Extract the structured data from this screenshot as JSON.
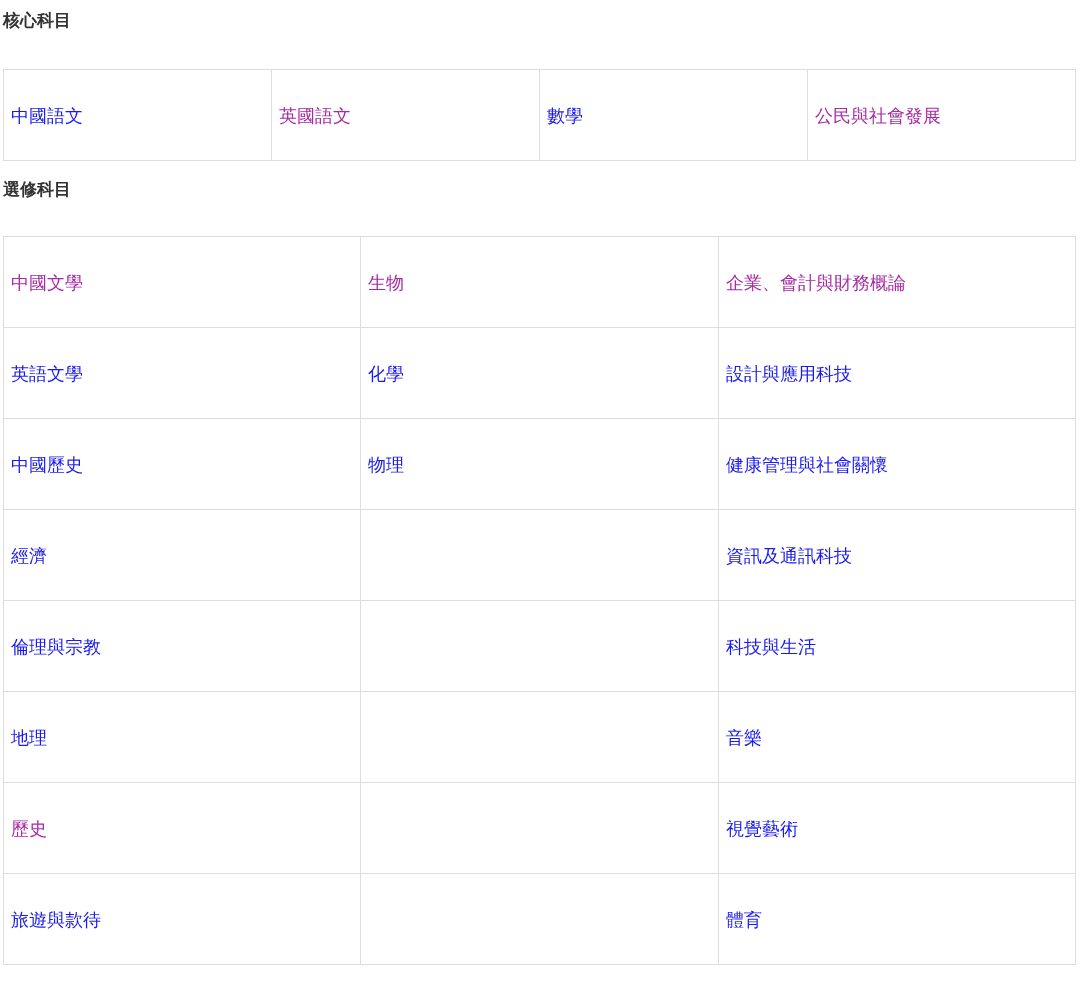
{
  "sections": [
    {
      "heading": "核心科目",
      "rows": [
        {
          "cells": [
            {
              "kind": "link",
              "label": "中國語文",
              "visited": false
            },
            {
              "kind": "link",
              "label": "英國語文",
              "visited": true
            },
            {
              "kind": "link",
              "label": "數學",
              "visited": false
            },
            {
              "kind": "link",
              "label": "公民與社會發展",
              "visited": true
            }
          ]
        }
      ]
    },
    {
      "heading": "選修科目",
      "rows": [
        {
          "cells": [
            {
              "kind": "link",
              "label": "中國文學",
              "visited": true
            },
            {
              "kind": "link",
              "label": "生物",
              "visited": true
            },
            {
              "kind": "link",
              "label": "企業、會計與財務概論",
              "visited": true
            }
          ]
        },
        {
          "cells": [
            {
              "kind": "link",
              "label": "英語文學",
              "visited": false
            },
            {
              "kind": "link",
              "label": "化學",
              "visited": false
            },
            {
              "kind": "link",
              "label": "設計與應用科技",
              "visited": false
            }
          ]
        },
        {
          "cells": [
            {
              "kind": "link",
              "label": "中國歷史",
              "visited": false
            },
            {
              "kind": "link",
              "label": "物理",
              "visited": false
            },
            {
              "kind": "link",
              "label": "健康管理與社會關懷",
              "visited": false
            }
          ]
        },
        {
          "cells": [
            {
              "kind": "link",
              "label": "經濟",
              "visited": false
            },
            {
              "kind": "empty"
            },
            {
              "kind": "link",
              "label": "資訊及通訊科技",
              "visited": false
            }
          ]
        },
        {
          "cells": [
            {
              "kind": "link",
              "label": "倫理與宗教",
              "visited": false
            },
            {
              "kind": "empty"
            },
            {
              "kind": "link",
              "label": "科技與生活",
              "visited": false
            }
          ]
        },
        {
          "cells": [
            {
              "kind": "link",
              "label": "地理",
              "visited": false
            },
            {
              "kind": "empty"
            },
            {
              "kind": "link",
              "label": "音樂",
              "visited": false
            }
          ]
        },
        {
          "cells": [
            {
              "kind": "link",
              "label": "歷史",
              "visited": true
            },
            {
              "kind": "empty"
            },
            {
              "kind": "link",
              "label": "視覺藝術",
              "visited": false
            }
          ]
        },
        {
          "cells": [
            {
              "kind": "link",
              "label": "旅遊與款待",
              "visited": false
            },
            {
              "kind": "empty"
            },
            {
              "kind": "link",
              "label": "體育",
              "visited": false
            }
          ]
        }
      ]
    }
  ]
}
